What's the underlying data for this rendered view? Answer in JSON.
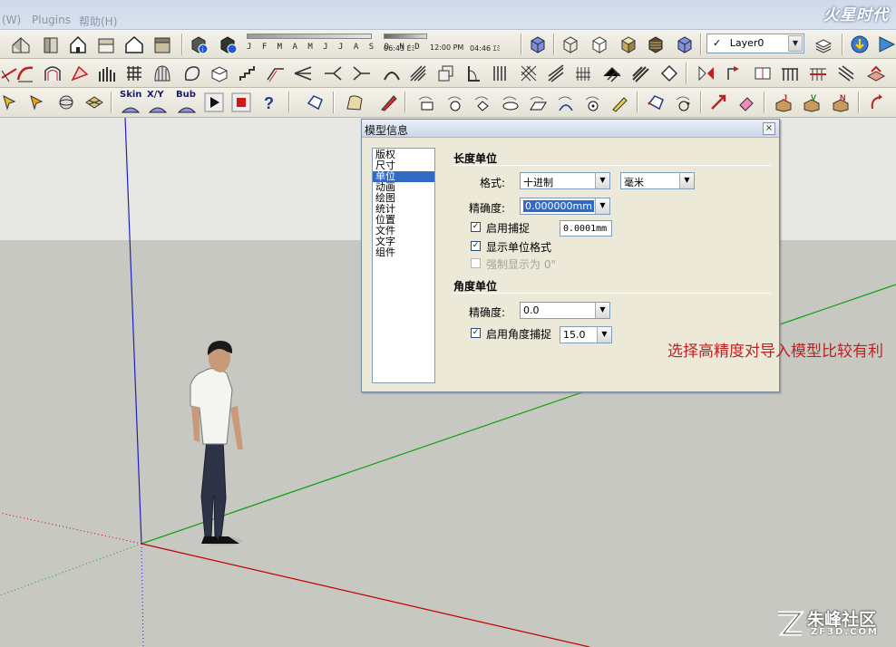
{
  "menu": {
    "partial_item": "(W)",
    "plugins": "Plugins",
    "help": "帮助(H)"
  },
  "toolbar": {
    "calendar_months": "J F M A M J J A S O N D",
    "time_start": "06:43 Éﾐ",
    "time_noon": "12:00 PM",
    "time_end": "04:46 ｴﾐ",
    "layer_name": "Layer0",
    "skin_label": "Skin",
    "xy_label": "X/Y",
    "bub_label": "Bub"
  },
  "dialog": {
    "title": "模型信息",
    "close": "×",
    "categories": [
      "版权",
      "尺寸",
      "单位",
      "动画",
      "绘图",
      "统计",
      "位置",
      "文件",
      "文字",
      "组件"
    ],
    "selected_category": "单位",
    "length_section": "长度单位",
    "format_label": "格式:",
    "format_value": "十进制",
    "unit_value": "毫米",
    "precision_label": "精确度:",
    "precision_value": "0.000000mm",
    "enable_snap_label": "启用捕捉",
    "enable_snap_checked": true,
    "snap_value": "0.0001mm",
    "show_unit_format_label": "显示单位格式",
    "show_unit_format_checked": true,
    "force_inches_label": "强制显示为 0\"",
    "force_inches_checked": false,
    "angle_section": "角度单位",
    "angle_precision_label": "精确度:",
    "angle_precision_value": "0.0",
    "enable_angle_snap_label": "启用角度捕捉",
    "enable_angle_snap_checked": true,
    "angle_snap_value": "15.0"
  },
  "annotation": {
    "text": "选择高精度对导入模型比较有利",
    "color": "#c02020"
  },
  "watermark": {
    "name": "朱峰社区",
    "url": "ZF3D.COM"
  },
  "colors": {
    "red_axis": "#c00000",
    "green_axis": "#10a010",
    "blue_axis": "#2020c0",
    "selection": "#316ac5"
  }
}
